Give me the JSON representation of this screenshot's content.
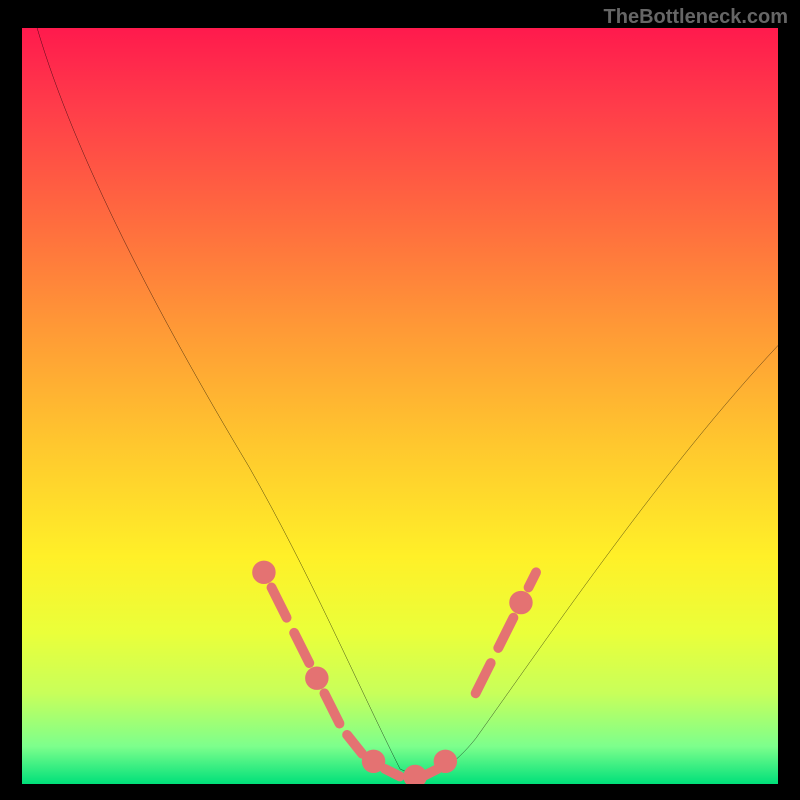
{
  "watermark": "TheBottleneck.com",
  "chart_data": {
    "type": "line",
    "title": "",
    "xlabel": "",
    "ylabel": "",
    "xlim": [
      0,
      100
    ],
    "ylim": [
      0,
      100
    ],
    "grid": false,
    "legend": false,
    "series": [
      {
        "name": "curve-black",
        "color": "#000000",
        "x": [
          2,
          6,
          12,
          18,
          24,
          30,
          35,
          40,
          44,
          47,
          50,
          53,
          56,
          60,
          64,
          68,
          72,
          76,
          80,
          84,
          88,
          92,
          96,
          100
        ],
        "y": [
          100,
          92,
          82,
          72,
          62,
          52,
          42,
          32,
          22,
          14,
          6,
          1,
          1,
          4,
          10,
          17,
          24,
          30,
          36,
          42,
          47,
          51,
          55,
          58
        ]
      },
      {
        "name": "highlight-dots",
        "color": "#e86f6f",
        "style": "dashed",
        "x": [
          32,
          35,
          38,
          41,
          44,
          47,
          50,
          53,
          56
        ],
        "y": [
          28,
          22,
          16,
          10,
          6,
          3,
          1,
          1,
          3
        ]
      },
      {
        "name": "highlight-dots-right",
        "color": "#e86f6f",
        "style": "dashed",
        "x": [
          60,
          62,
          64,
          66,
          68
        ],
        "y": [
          12,
          16,
          19,
          22,
          26
        ]
      }
    ],
    "background_gradient": {
      "top": "#ff1a4d",
      "mid": "#ffd52e",
      "bottom": "#00e07a"
    }
  }
}
